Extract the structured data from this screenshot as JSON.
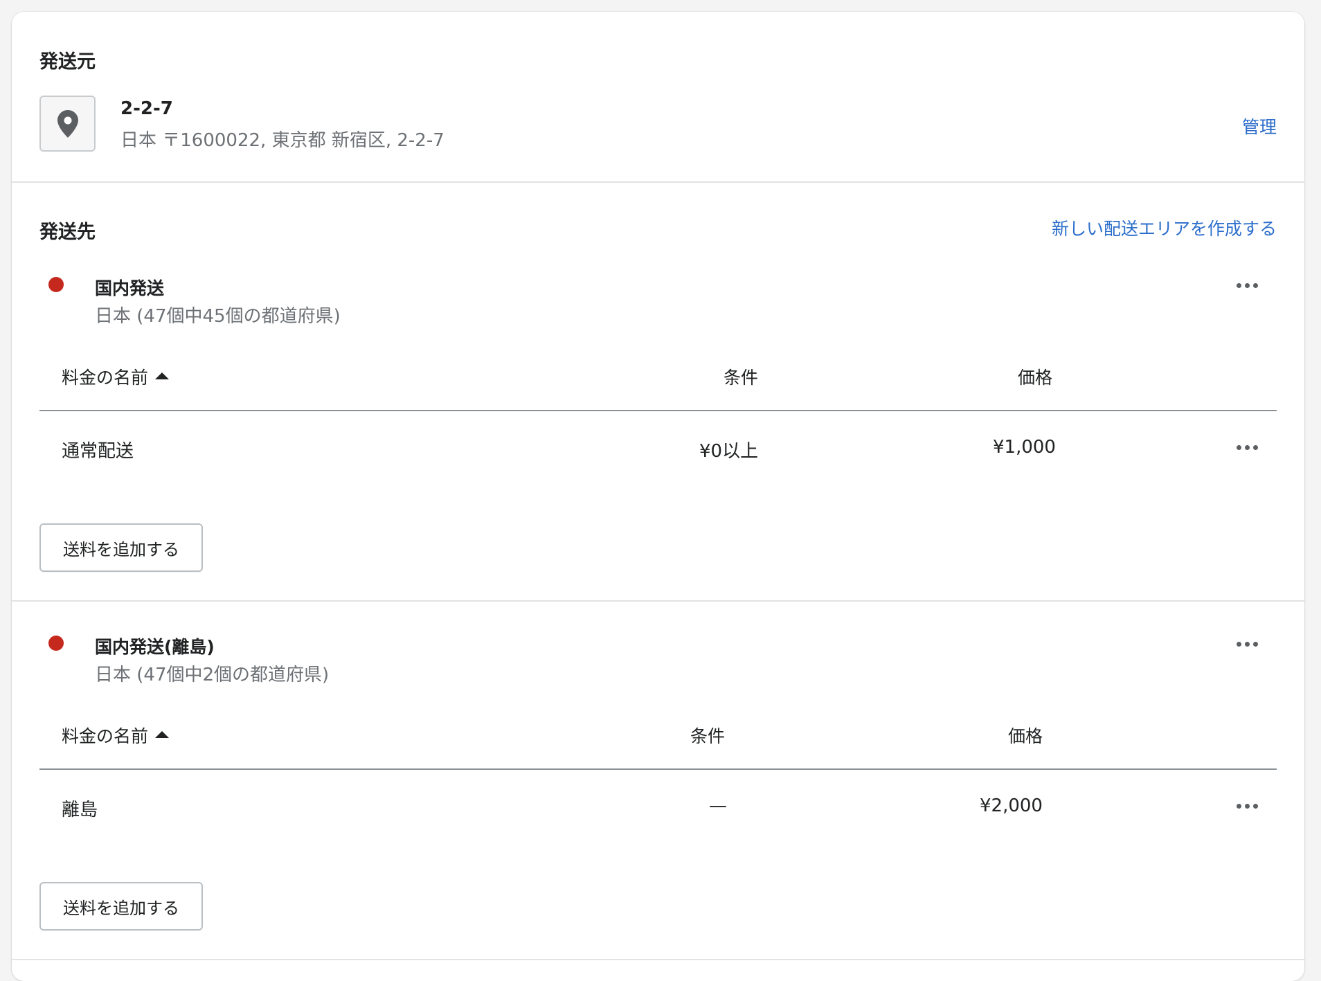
{
  "origin": {
    "title": "発送元",
    "location_name": "2-2-7",
    "location_address": "日本 〒1600022, 東京都 新宿区, 2-2-7",
    "manage_label": "管理"
  },
  "destination": {
    "title": "発送先",
    "create_zone_label": "新しい配送エリアを作成する"
  },
  "zones": [
    {
      "name": "国内発送",
      "region": "日本 (47個中45個の都道府県)",
      "status_color": "#c5281c",
      "columns": [
        "料金の名前",
        "条件",
        "価格"
      ],
      "rates": [
        {
          "name": "通常配送",
          "condition": "¥0以上",
          "price": "¥1,000"
        }
      ],
      "add_rate_label": "送料を追加する"
    },
    {
      "name": "国内発送(離島)",
      "region": "日本 (47個中2個の都道府県)",
      "status_color": "#c5281c",
      "columns": [
        "料金の名前",
        "条件",
        "価格"
      ],
      "rates": [
        {
          "name": "離島",
          "condition": "—",
          "price": "¥2,000"
        }
      ],
      "add_rate_label": "送料を追加する"
    }
  ],
  "colors": {
    "link": "#2c6ecb",
    "status_dot": "#c5281c",
    "text": "#202223",
    "subdued_text": "#6d7175"
  }
}
